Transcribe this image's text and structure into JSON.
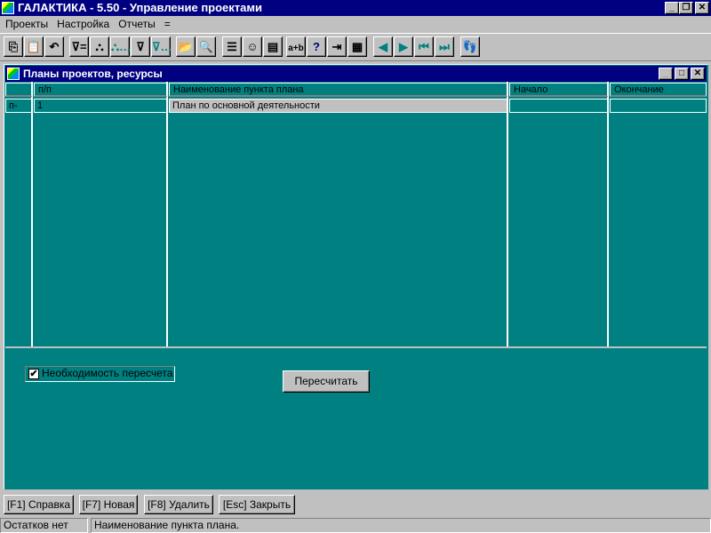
{
  "app": {
    "title": "ГАЛАКТИКА - 5.50 - Управление проектами"
  },
  "menu": [
    "Проекты",
    "Настройка",
    "Отчеты",
    "="
  ],
  "toolbar": [
    {
      "name": "copy-icon",
      "glyph": "⎘"
    },
    {
      "name": "paste-icon",
      "glyph": "📋"
    },
    {
      "name": "undo-icon",
      "glyph": "↶"
    },
    {
      "name": "filter-icon",
      "glyph": "⊽="
    },
    {
      "name": "search-binoculars-icon",
      "glyph": "⛬"
    },
    {
      "name": "search-next-icon",
      "glyph": "⛬…"
    },
    {
      "name": "filter-search-icon",
      "glyph": "⊽"
    },
    {
      "name": "filter-search-next-icon",
      "glyph": "⊽…"
    },
    {
      "name": "open-folder-icon",
      "glyph": "📂"
    },
    {
      "name": "folder-search-icon",
      "glyph": "🔍"
    },
    {
      "name": "numbered-list-icon",
      "glyph": "☰"
    },
    {
      "name": "smiley-icon",
      "glyph": "☺"
    },
    {
      "name": "records-icon",
      "glyph": "▤"
    },
    {
      "name": "calculator-icon",
      "glyph": "a+b"
    },
    {
      "name": "help-icon",
      "glyph": "?"
    },
    {
      "name": "exit-icon",
      "glyph": "⇥"
    },
    {
      "name": "form-icon",
      "glyph": "▦"
    },
    {
      "name": "prev-icon",
      "glyph": "◀"
    },
    {
      "name": "next-icon",
      "glyph": "▶"
    },
    {
      "name": "first-icon",
      "glyph": "⏮"
    },
    {
      "name": "last-icon",
      "glyph": "⏭"
    },
    {
      "name": "footprints-icon",
      "glyph": "👣"
    }
  ],
  "child": {
    "title": "Планы проектов, ресурсы"
  },
  "grid": {
    "headers": [
      "",
      "п/п",
      "Наименование пункта плана",
      "Начало",
      "Окончание"
    ],
    "rows": [
      [
        "п-",
        "1",
        "План по основной деятельности",
        "",
        ""
      ]
    ]
  },
  "options": {
    "recalc_needed_label": "Необходимость пересчета",
    "recalc_needed_checked": true,
    "recalc_button": "Пересчитать"
  },
  "fkeys": [
    "[F1] Справка",
    "[F7] Новая",
    "[F8] Удалить",
    "[Esc] Закрыть"
  ],
  "status": {
    "left": "Остатков нет",
    "right": "Наименование пункта плана."
  }
}
